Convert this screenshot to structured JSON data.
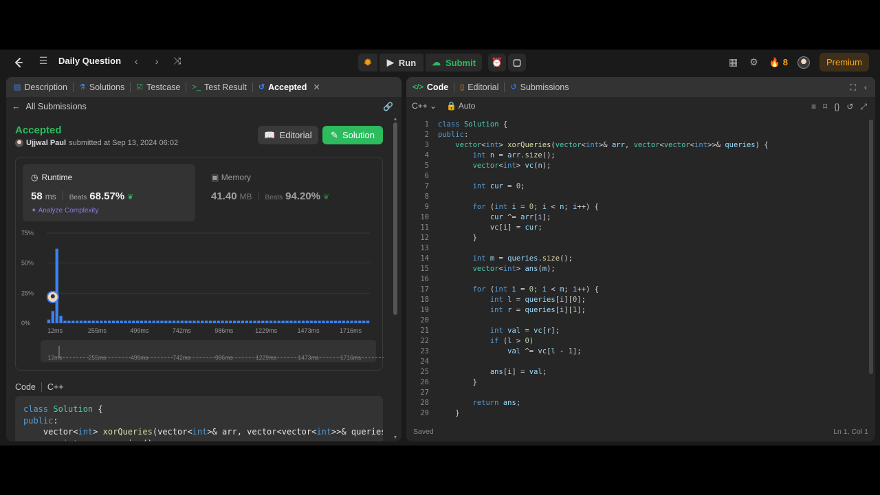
{
  "nav": {
    "title": "Daily Question",
    "run_label": "Run",
    "submit_label": "Submit",
    "streak": "8",
    "premium_label": "Premium"
  },
  "left_tabs": [
    "Description",
    "Solutions",
    "Testcase",
    "Test Result",
    "Accepted"
  ],
  "submission": {
    "back_label": "All Submissions",
    "status": "Accepted",
    "user": "Ujjwal Paul",
    "submitted_text": "submitted at Sep 13, 2024 06:02",
    "editorial_label": "Editorial",
    "solution_label": "Solution"
  },
  "runtime": {
    "label": "Runtime",
    "value": "58",
    "unit": "ms",
    "beats_label": "Beats",
    "beats_value": "68.57%",
    "analyze_label": "Analyze Complexity"
  },
  "memory": {
    "label": "Memory",
    "value": "41.40",
    "unit": "MB",
    "beats_label": "Beats",
    "beats_value": "94.20%"
  },
  "chart_data": {
    "type": "bar",
    "ylim": [
      0,
      75
    ],
    "y_ticks": [
      "75%",
      "50%",
      "25%",
      "0%"
    ],
    "x_ticks": [
      "12ms",
      "255ms",
      "499ms",
      "742ms",
      "986ms",
      "1229ms",
      "1473ms",
      "1716ms"
    ],
    "values": [
      3,
      10,
      62,
      6,
      2,
      2,
      2,
      2,
      2,
      2,
      2,
      2,
      2,
      2,
      2,
      2,
      2,
      2,
      2,
      2,
      2,
      2,
      2,
      2,
      2,
      2,
      2,
      2,
      2,
      2,
      2,
      2,
      2,
      2,
      2,
      2,
      2,
      2,
      2,
      2,
      2,
      2,
      2,
      2,
      2,
      2,
      2,
      2,
      2,
      2,
      2,
      2,
      2,
      2,
      2,
      2,
      2,
      2,
      2,
      2,
      2,
      2,
      2,
      2,
      2,
      2,
      2,
      2,
      2,
      2,
      2,
      2,
      2,
      2,
      2,
      2,
      2,
      2,
      2,
      2
    ],
    "bar_color": "#3b82f6"
  },
  "code_section": {
    "label": "Code",
    "lang": "C++",
    "lines": [
      "class Solution {",
      "public:",
      "    vector<int> xorQueries(vector<int>& arr, vector<vector<int>>& queries) {",
      "        int n = arr.size();"
    ]
  },
  "right_tabs": [
    "Code",
    "Editorial",
    "Submissions"
  ],
  "editor": {
    "language": "C++",
    "mode": "Auto",
    "status_left": "Saved",
    "status_right": "Ln 1, Col 1",
    "lines": [
      "class Solution {",
      "public:",
      "    vector<int> xorQueries(vector<int>& arr, vector<vector<int>>& queries) {",
      "        int n = arr.size();",
      "        vector<int> vc(n);",
      "",
      "        int cur = 0;",
      "",
      "        for (int i = 0; i < n; i++) {",
      "            cur ^= arr[i];",
      "            vc[i] = cur;",
      "        }",
      "",
      "        int m = queries.size();",
      "        vector<int> ans(m);",
      "",
      "        for (int i = 0; i < m; i++) {",
      "            int l = queries[i][0];",
      "            int r = queries[i][1];",
      "",
      "            int val = vc[r];",
      "            if (l > 0)",
      "                val ^= vc[l - 1];",
      "",
      "            ans[i] = val;",
      "        }",
      "",
      "        return ans;",
      "    }"
    ]
  },
  "colors": {
    "accent_green": "#2cbb5d",
    "accent_orange": "#ffa116",
    "bg": "#262626"
  }
}
